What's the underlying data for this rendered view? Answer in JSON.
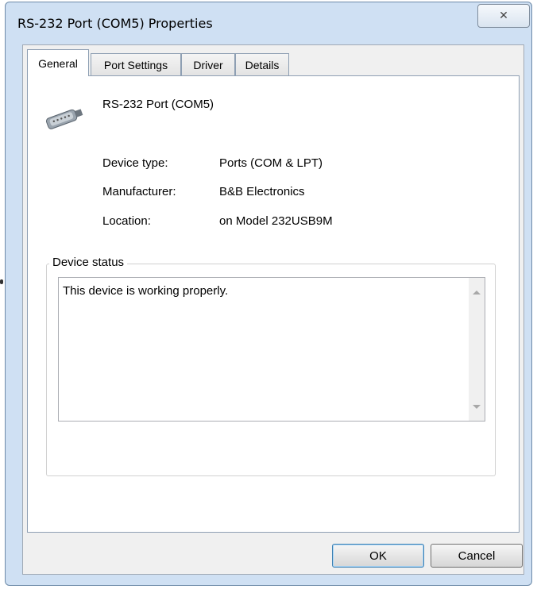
{
  "window": {
    "title": "RS-232 Port (COM5) Properties",
    "close_glyph": "✕"
  },
  "tabs": [
    {
      "label": "General",
      "active": true
    },
    {
      "label": "Port Settings",
      "active": false
    },
    {
      "label": "Driver",
      "active": false
    },
    {
      "label": "Details",
      "active": false
    }
  ],
  "device": {
    "icon": "serial-port-connector-icon",
    "name": "RS-232 Port (COM5)",
    "properties": [
      {
        "label": "Device type:",
        "value": "Ports (COM & LPT)"
      },
      {
        "label": "Manufacturer:",
        "value": "B&B Electronics"
      },
      {
        "label": "Location:",
        "value": "on Model 232USB9M"
      }
    ]
  },
  "status": {
    "group_label": "Device status",
    "text": "This device is working properly."
  },
  "buttons": {
    "ok": "OK",
    "cancel": "Cancel"
  }
}
